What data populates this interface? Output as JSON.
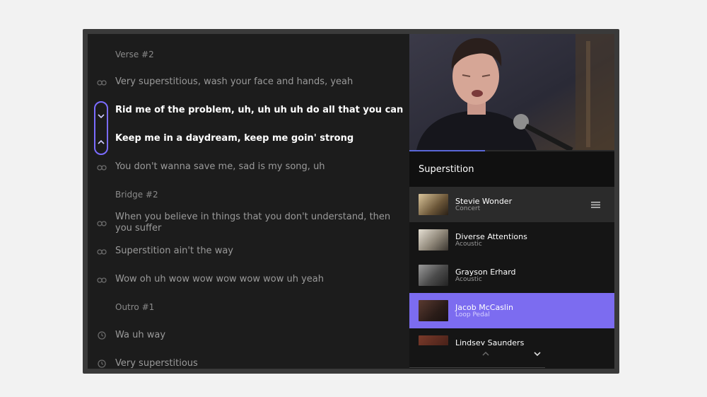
{
  "lyrics": {
    "rows": [
      {
        "type": "section",
        "text": "Verse #2"
      },
      {
        "type": "line",
        "text": "Very superstitious, wash your face and hands, yeah",
        "icon": "loop-icon",
        "active": false
      },
      {
        "type": "line",
        "text": "Rid me of the problem, uh, uh uh uh do all that you can",
        "icon": "chevron-down-icon",
        "active": true
      },
      {
        "type": "line",
        "text": "Keep me in a daydream, keep me goin' strong",
        "icon": "chevron-up-icon",
        "active": true
      },
      {
        "type": "line",
        "text": "You don't wanna save me, sad is my song, uh",
        "icon": "loop-icon",
        "active": false
      },
      {
        "type": "section",
        "text": "Bridge #2"
      },
      {
        "type": "line",
        "text": "When you believe in things that you don't understand, then you suffer",
        "icon": "loop-icon",
        "active": false
      },
      {
        "type": "line",
        "text": "Superstition ain't the way",
        "icon": "loop-icon",
        "active": false
      },
      {
        "type": "line",
        "text": "Wow oh uh wow wow wow wow wow uh yeah",
        "icon": "loop-icon",
        "active": false
      },
      {
        "type": "section",
        "text": "Outro #1"
      },
      {
        "type": "line",
        "text": "Wa uh way",
        "icon": "sync-icon",
        "active": false
      },
      {
        "type": "line",
        "text": "Very superstitious",
        "icon": "sync-icon",
        "active": false
      }
    ]
  },
  "player": {
    "song_title": "Superstition",
    "progress_fraction": 0.37
  },
  "versions": [
    {
      "artist": "Stevie Wonder",
      "style": "Concert",
      "state": "current",
      "menu_icon": "drag-handle-icon"
    },
    {
      "artist": "Diverse Attentions",
      "style": "Acoustic",
      "state": "normal"
    },
    {
      "artist": "Grayson Erhard",
      "style": "Acoustic",
      "state": "normal"
    },
    {
      "artist": "Jacob McCaslin",
      "style": "Loop Pedal",
      "state": "selected"
    },
    {
      "artist": "Lindsey Saunders",
      "style": "",
      "state": "normal"
    }
  ],
  "colors": {
    "accent": "#7c6cf0",
    "highlight_border": "#7b6cff",
    "progress": "#5a67d8"
  },
  "icons": {
    "pager_up": "chevron-up-icon",
    "pager_down": "chevron-down-icon"
  }
}
